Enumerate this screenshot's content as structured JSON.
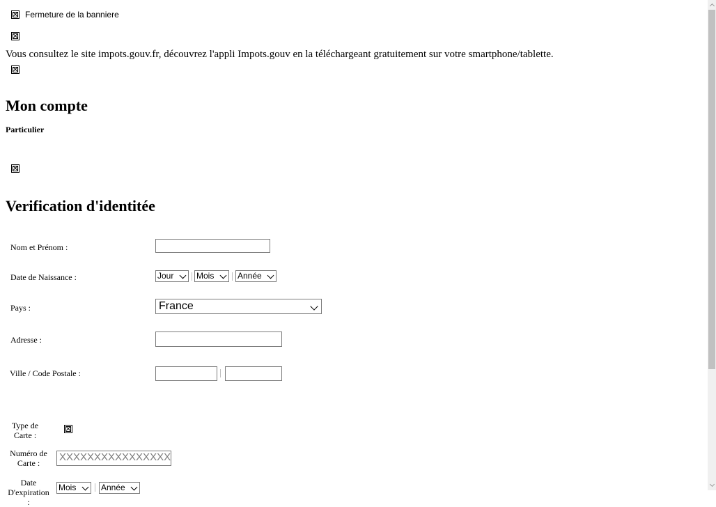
{
  "banner": {
    "close_label": "Fermeture de la banniere",
    "message": "Vous consultez le site impots.gouv.fr, découvrez l'appli Impots.gouv en la téléchargeant gratuitement sur votre smartphone/tablette."
  },
  "header": {
    "title": "Mon compte",
    "subtitle": "Particulier"
  },
  "form": {
    "title": "Verification d'identitée",
    "name_label": "Nom et Prénom :",
    "name_value": "",
    "dob_label": "Date de Naissance :",
    "dob_day": "Jour",
    "dob_month": "Mois",
    "dob_year": "Année",
    "country_label": "Pays :",
    "country_value": "France",
    "address_label": "Adresse :",
    "address_value": "",
    "city_label": "Ville / Code Postale :",
    "city_value": "",
    "postal_value": "",
    "card_type_label": "Type de Carte :",
    "card_number_label": "Numéro de Carte :",
    "card_number_placeholder": "XXXXXXXXXXXXXXXX",
    "expiry_label": "Date D'expiration :",
    "expiry_month": "Mois",
    "expiry_year": "Année"
  }
}
